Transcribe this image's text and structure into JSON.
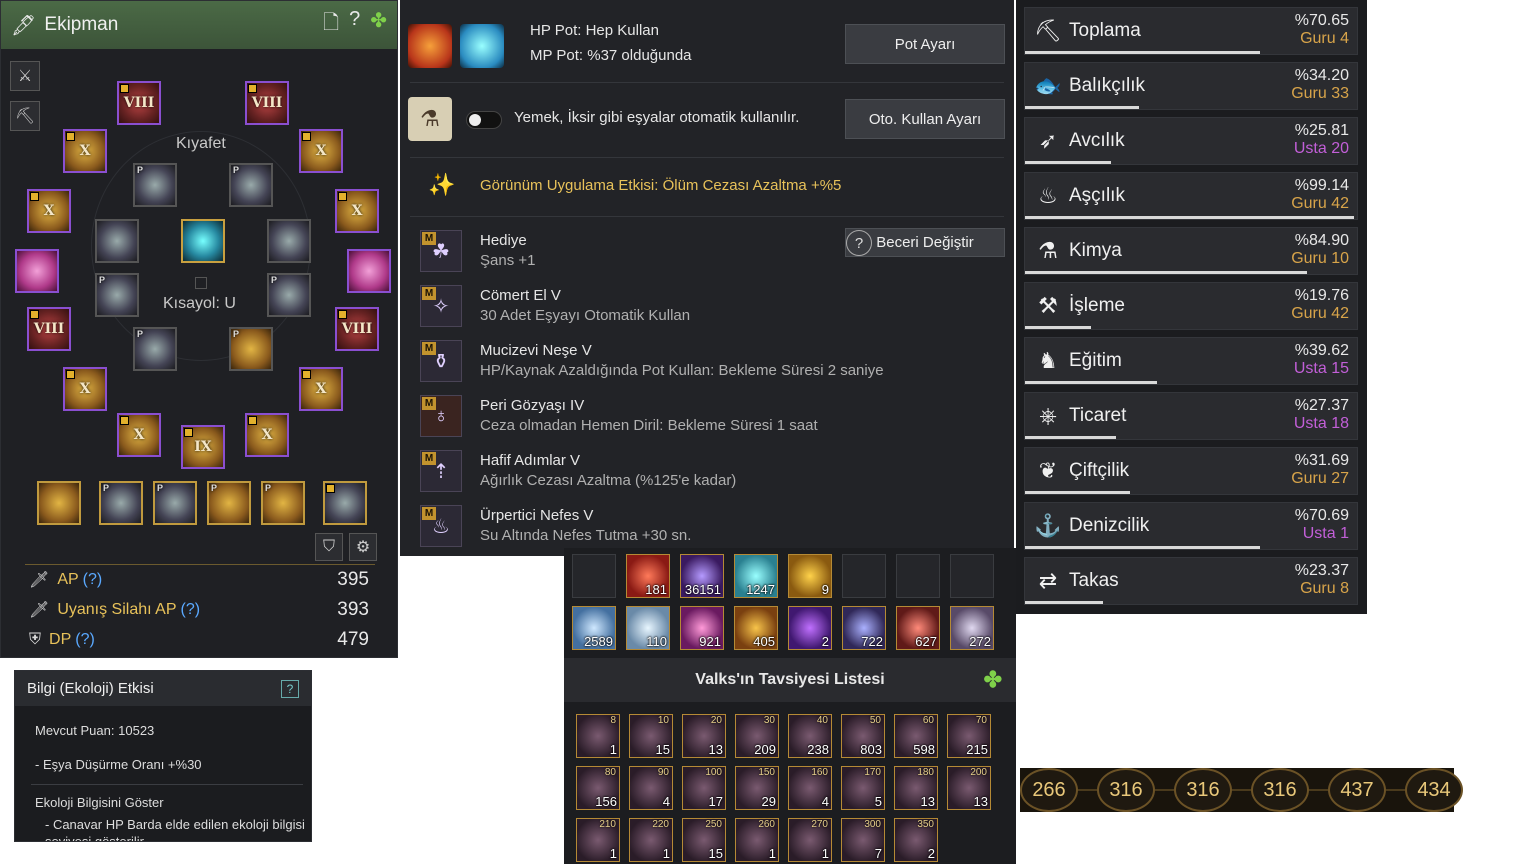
{
  "equipment": {
    "title": "Ekipman",
    "costume_label": "Kıyafet",
    "shortcut_label": "Kısayol: U",
    "roman_numerals": [
      "VIII",
      "VIII",
      "VIII",
      "VIII",
      "IX"
    ],
    "roman_x": "X",
    "stats": [
      {
        "label": "AP",
        "help": "(?)",
        "value": "395"
      },
      {
        "label": "Uyanış Silahı AP",
        "help": "(?)",
        "value": "393"
      },
      {
        "label": "DP",
        "help": "(?)",
        "value": "479"
      }
    ]
  },
  "ecology": {
    "title": "Bilgi (Ekoloji) Etkisi",
    "help": "?",
    "points_label": "Mevcut Puan:",
    "points_value": "10523",
    "effect": "- Eşya Düşürme Oranı +%30",
    "show_title": "Ekoloji Bilgisini Göster",
    "show_desc": "- Canavar HP Barda elde edilen ekoloji bilgisi seviyesi gösterilir"
  },
  "pot": {
    "hp_pot": "HP Pot: Hep Kullan",
    "mp_pot": "MP Pot: %37 olduğunda",
    "pot_button": "Pot Ayarı",
    "auto_text": "Yemek, İksir gibi eşyalar otomatik kullanılır.",
    "auto_button": "Oto. Kullan Ayarı",
    "appearance_effect": "Görünüm Uygulama Etkisi: Ölüm Cezası Azaltma +%5",
    "help": "?",
    "change_skill_button": "Beceri Değiştir",
    "badge": "M",
    "skills": [
      {
        "name": "Hediye",
        "desc": "Şans +1"
      },
      {
        "name": "Cömert El V",
        "desc": "30 Adet Eşyayı Otomatik Kullan"
      },
      {
        "name": "Mucizevi Neşe V",
        "desc": "HP/Kaynak Azaldığında Pot Kullan: Bekleme Süresi 2 saniye"
      },
      {
        "name": "Peri Gözyaşı IV",
        "desc": "Ceza olmadan Hemen Diril: Bekleme Süresi 1 saat"
      },
      {
        "name": "Hafif Adımlar V",
        "desc": "Ağırlık Cezası Azaltma (%125'e kadar)"
      },
      {
        "name": "Ürpertici Nefes V",
        "desc": "Su Altında Nefes Tutma +30 sn."
      }
    ]
  },
  "inventory": {
    "row1": [
      "",
      "181",
      "36151",
      "1247",
      "9",
      "",
      "",
      ""
    ],
    "row2": [
      "2589",
      "110",
      "921",
      "405",
      "2",
      "722",
      "627",
      "272"
    ]
  },
  "valks": {
    "title": "Valks'ın Tavsiyesi Listesi",
    "items": [
      {
        "level": "8",
        "count": "1"
      },
      {
        "level": "10",
        "count": "15"
      },
      {
        "level": "20",
        "count": "13"
      },
      {
        "level": "30",
        "count": "209"
      },
      {
        "level": "40",
        "count": "238"
      },
      {
        "level": "50",
        "count": "803"
      },
      {
        "level": "60",
        "count": "598"
      },
      {
        "level": "70",
        "count": "215"
      },
      {
        "level": "80",
        "count": "156"
      },
      {
        "level": "90",
        "count": "4"
      },
      {
        "level": "100",
        "count": "17"
      },
      {
        "level": "150",
        "count": "29"
      },
      {
        "level": "160",
        "count": "4"
      },
      {
        "level": "170",
        "count": "5"
      },
      {
        "level": "180",
        "count": "13"
      },
      {
        "level": "200",
        "count": "13"
      },
      {
        "level": "210",
        "count": "1"
      },
      {
        "level": "220",
        "count": "1"
      },
      {
        "level": "250",
        "count": "15"
      },
      {
        "level": "260",
        "count": "1"
      },
      {
        "level": "270",
        "count": "1"
      },
      {
        "level": "300",
        "count": "7"
      },
      {
        "level": "350",
        "count": "2"
      }
    ]
  },
  "life_skills": [
    {
      "name": "Toplama",
      "percent": "%70.65",
      "rank": "Guru 4",
      "progress": 0.7065,
      "tier": "guru",
      "icon": "pickaxe-icon"
    },
    {
      "name": "Balıkçılık",
      "percent": "%34.20",
      "rank": "Guru 33",
      "progress": 0.342,
      "tier": "guru",
      "icon": "fish-icon"
    },
    {
      "name": "Avcılık",
      "percent": "%25.81",
      "rank": "Usta 20",
      "progress": 0.2581,
      "tier": "usta",
      "icon": "harpoon-icon"
    },
    {
      "name": "Aşçılık",
      "percent": "%99.14",
      "rank": "Guru 42",
      "progress": 0.9914,
      "tier": "guru",
      "icon": "cooking-pot-icon"
    },
    {
      "name": "Kimya",
      "percent": "%84.90",
      "rank": "Guru 10",
      "progress": 0.849,
      "tier": "guru",
      "icon": "flask-icon"
    },
    {
      "name": "İşleme",
      "percent": "%19.76",
      "rank": "Guru 42",
      "progress": 0.1976,
      "tier": "guru",
      "icon": "hammer-icon"
    },
    {
      "name": "Eğitim",
      "percent": "%39.62",
      "rank": "Usta 15",
      "progress": 0.3962,
      "tier": "usta",
      "icon": "horse-icon"
    },
    {
      "name": "Ticaret",
      "percent": "%27.37",
      "rank": "Usta 18",
      "progress": 0.2737,
      "tier": "usta",
      "icon": "wheel-icon"
    },
    {
      "name": "Çiftçilik",
      "percent": "%31.69",
      "rank": "Guru 27",
      "progress": 0.3169,
      "tier": "guru",
      "icon": "sprout-icon"
    },
    {
      "name": "Denizcilik",
      "percent": "%70.69",
      "rank": "Usta 1",
      "progress": 0.7069,
      "tier": "usta",
      "icon": "anchor-icon"
    },
    {
      "name": "Takas",
      "percent": "%23.37",
      "rank": "Guru 8",
      "progress": 0.2337,
      "tier": "guru",
      "icon": "swap-icon"
    }
  ],
  "colors": {
    "guru": "#d8a44a",
    "usta": "#c25fd8",
    "accent_gold": "#e8c25a"
  },
  "bottom_numbers": [
    "266",
    "316",
    "316",
    "316",
    "437",
    "434"
  ]
}
